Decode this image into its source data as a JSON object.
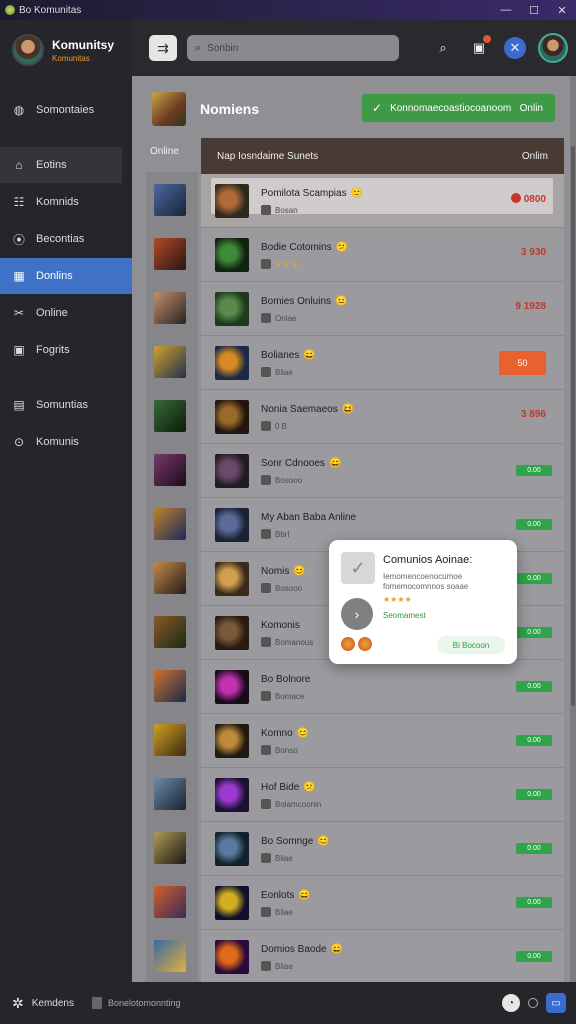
{
  "titlebar": {
    "title": "Bo Komunitas",
    "minimize": "—",
    "maximize": "☐",
    "close": "✕"
  },
  "brand": {
    "title": "Komunitsy",
    "subtitle": "Komunitas"
  },
  "sidebar": {
    "items": [
      {
        "label": "Somontaies",
        "icon": "globe-icon",
        "glyph": "◍"
      },
      {
        "label": "Eotins",
        "icon": "home-icon",
        "glyph": "⌂"
      },
      {
        "label": "Komnids",
        "icon": "people-icon",
        "glyph": "☷"
      },
      {
        "label": "Becontias",
        "icon": "circle-icon",
        "glyph": "⦿"
      },
      {
        "label": "Donlins",
        "icon": "store-icon",
        "glyph": "▦"
      },
      {
        "label": "Online",
        "icon": "tools-icon",
        "glyph": "✂"
      },
      {
        "label": "Fogrits",
        "icon": "square-icon",
        "glyph": "▣"
      },
      {
        "label": "Somuntias",
        "icon": "chat-icon",
        "glyph": "▤"
      },
      {
        "label": "Komunis",
        "icon": "ring-icon",
        "glyph": "⊙"
      }
    ]
  },
  "topbar": {
    "search_placeholder": "Sonbin"
  },
  "main": {
    "title": "Nomiens",
    "online_button": "Konnomaecoastiocoanoom",
    "online_button_right": "Onlin",
    "side_label": "Online",
    "table_header_left": "Nap Iosndaime Sunets",
    "table_header_right": "Onlim"
  },
  "rows": [
    {
      "name": "Pomilota Scampias",
      "emoji": "🙂",
      "sub": "Bosan",
      "type": "price",
      "value": "0800",
      "featured": true
    },
    {
      "name": "Bodie Cotomins",
      "emoji": "😕",
      "sub": "★★★",
      "type": "price",
      "value": "3 930"
    },
    {
      "name": "Bomies Onluins",
      "emoji": "😐",
      "sub": "Onlae",
      "type": "price",
      "value": "9 1928"
    },
    {
      "name": "Bolianes",
      "emoji": "😄",
      "sub": "Bliae",
      "type": "card",
      "value": "50"
    },
    {
      "name": "Nonia Saemaeos",
      "emoji": "😆",
      "sub": "0 B",
      "type": "price",
      "value": "3 896"
    },
    {
      "name": "Sonr Cdnooes",
      "emoji": "😄",
      "sub": "Bosooo",
      "type": "pill",
      "value": "0.00"
    },
    {
      "name": "My Aban Baba Anline",
      "emoji": "",
      "sub": "Bbrl",
      "type": "pill",
      "value": "0.00"
    },
    {
      "name": "Nomis",
      "emoji": "😊",
      "sub": "Bosooo",
      "type": "pill",
      "value": "0.00"
    },
    {
      "name": "Komonis",
      "emoji": "",
      "sub": "Bomanous",
      "type": "pill",
      "value": "0.00"
    },
    {
      "name": "Bo Bolnore",
      "emoji": "",
      "sub": "Bomace",
      "type": "pill",
      "value": "0.00"
    },
    {
      "name": "Komno",
      "emoji": "😊",
      "sub": "Bonso",
      "type": "pill",
      "value": "0.00"
    },
    {
      "name": "Hof Bide",
      "emoji": "😕",
      "sub": "Bolamcoonin",
      "type": "pill",
      "value": "0.00"
    },
    {
      "name": "Bo Somnge",
      "emoji": "😊",
      "sub": "Bliae",
      "type": "pill",
      "value": "0.00"
    },
    {
      "name": "Eonlots",
      "emoji": "😄",
      "sub": "Bliae",
      "type": "pill",
      "value": "0.00"
    },
    {
      "name": "Domios Baode",
      "emoji": "😄",
      "sub": "Bliae",
      "type": "pill",
      "value": "0.00"
    }
  ],
  "popup": {
    "title": "Comunios Aoinae:",
    "desc": "Iemomencoenocumoe fomemocomnnos soaae",
    "stars": "★★★★",
    "green_text": "Seomamest",
    "button": "Bi Bocoon"
  },
  "bottombar": {
    "label": "Kemdens",
    "file": "Bonelotomonnting"
  },
  "colors": {
    "accent": "#3f72c6",
    "green": "#3f9a45",
    "price_red": "#c8342b",
    "orange": "#e8612e"
  }
}
